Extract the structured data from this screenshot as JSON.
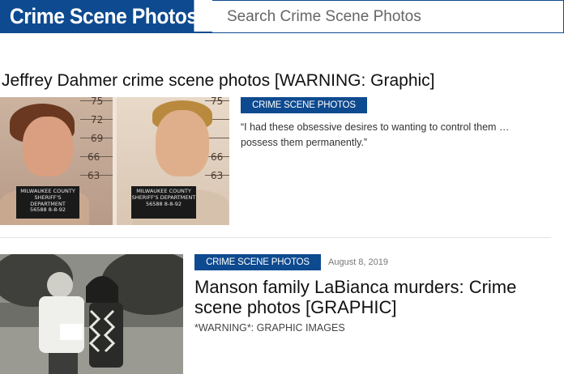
{
  "header": {
    "brand": "Crime Scene Photos",
    "search_placeholder": "Search Crime Scene Photos"
  },
  "posts": [
    {
      "title": "Jeffrey Dahmer crime scene photos [WARNING: Graphic]",
      "category": "CRIME SCENE PHOTOS",
      "excerpt": "“I had these obsessive desires to wanting to control them … possess them permanently.”",
      "image": {
        "height_marks": [
          "75",
          "72",
          "69",
          "66",
          "63"
        ],
        "plate_lines": [
          "MILWAUKEE COUNTY",
          "SHERIFF'S DEPARTMENT",
          "56588   8-8-92"
        ]
      }
    },
    {
      "title": "Manson family LaBianca murders: Crime scene photos [GRAPHIC]",
      "category": "CRIME SCENE PHOTOS",
      "date": "August 8, 2019",
      "excerpt": "*WARNING*: GRAPHIC IMAGES"
    }
  ]
}
